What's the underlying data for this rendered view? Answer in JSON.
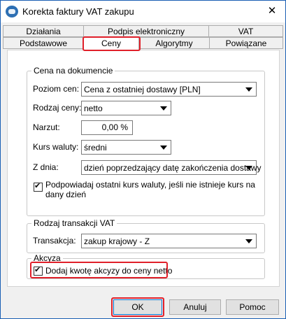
{
  "window": {
    "title": "Korekta faktury VAT zakupu",
    "close_glyph": "✕"
  },
  "tabs_top": [
    {
      "label": "Działania"
    },
    {
      "label": "Podpis elektroniczny"
    },
    {
      "label": "VAT"
    }
  ],
  "tabs_bottom": [
    {
      "label": "Podstawowe"
    },
    {
      "label": "Ceny"
    },
    {
      "label": "Algorytmy"
    },
    {
      "label": "Powiązane"
    }
  ],
  "active_tab": "Ceny",
  "price_group": {
    "legend": "Cena na dokumencie",
    "price_level": {
      "label": "Poziom cen:",
      "value": "Cena z ostatniej dostawy [PLN]"
    },
    "price_type": {
      "label": "Rodzaj ceny:",
      "value": "netto"
    },
    "markup": {
      "label": "Narzut:",
      "value": "0,00 %"
    },
    "exchange_rate": {
      "label": "Kurs waluty:",
      "value": "średni"
    },
    "from_day": {
      "label": "Z dnia:",
      "value": "dzień poprzedzający datę zakończenia dostawy"
    },
    "suggest_rate": {
      "label": "Podpowiadaj ostatni kurs waluty, jeśli nie istnieje kurs na dany dzień",
      "checked": true
    }
  },
  "vat_group": {
    "legend": "Rodzaj transakcji VAT",
    "transaction": {
      "label": "Transakcja:",
      "value": "zakup krajowy - Z"
    }
  },
  "excise_group": {
    "legend": "Akcyza",
    "add_excise": {
      "label": "Dodaj kwotę akcyzy do ceny netto",
      "checked": true
    }
  },
  "buttons": {
    "ok": "OK",
    "cancel": "Anuluj",
    "help": "Pomoc"
  }
}
